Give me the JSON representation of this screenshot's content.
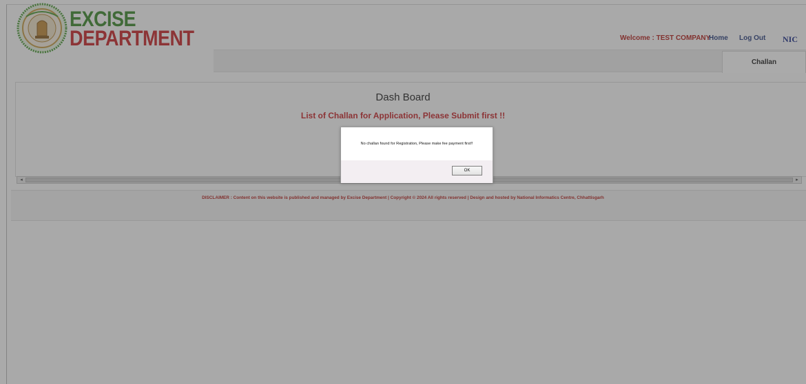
{
  "header": {
    "logo_line1": "EXCISE",
    "logo_line2": "DEPARTMENT",
    "welcome": "Welcome : TEST COMPANY",
    "nav_home": "Home",
    "nav_logout": "Log Out",
    "nav_nic": "NIC",
    "menu_challan": "Challan"
  },
  "dashboard": {
    "title": "Dash Board",
    "subtitle": "List of Challan for Application, Please Submit first !!"
  },
  "scrollbar": {
    "left_arrow": "◂",
    "right_arrow": "▸"
  },
  "footer": {
    "disclaimer": "DISCLAIMER : Content on this website is published and managed by Excise Department | Copyright © 2024 All rights reserved | Design and hosted by National Informatics Centre, Chhattisgarh"
  },
  "dialog": {
    "message": "No challan found for Registration, Please make fee payment first!!",
    "ok_label": "OK"
  },
  "colors": {
    "logo_green": "#3c8a2e",
    "logo_red": "#c8262a",
    "nav_blue": "#2a3f7e",
    "alert_red": "#b5221e"
  }
}
